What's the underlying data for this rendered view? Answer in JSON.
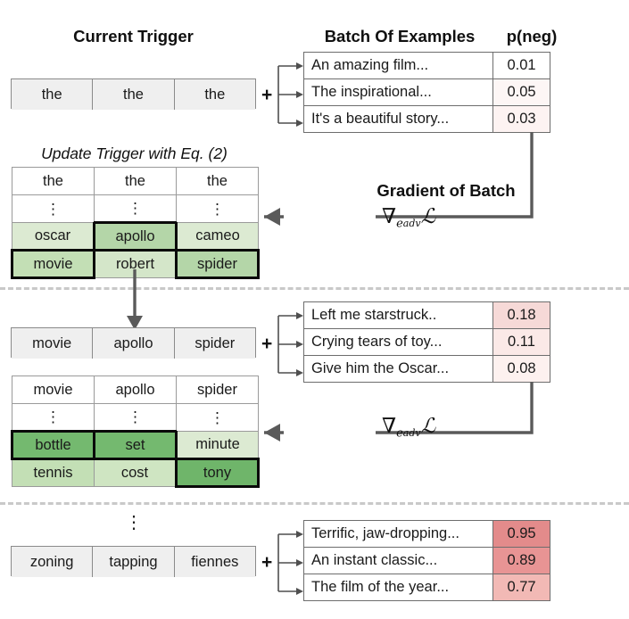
{
  "headings": {
    "current_trigger": "Current Trigger",
    "batch_of_examples": "Batch Of Examples",
    "p_neg": "p(neg)",
    "update_trigger": "Update Trigger with Eq. (2)",
    "gradient_of_batch": "Gradient of Batch"
  },
  "symbols": {
    "plus": "+",
    "nabla": "∇",
    "gradient_subscript": "e",
    "gradient_subscript2": "adv",
    "loss": "ℒ",
    "vertical_dots": "⋮"
  },
  "colors": {
    "green_dark": "#73b873",
    "green_mid": "#a7cfa0",
    "green_light": "#cfe3c4",
    "green_pale": "#e3eedc",
    "pink_dark": "#e08585",
    "pink_mid": "#eeaaaa",
    "pink_light": "#f8dede",
    "pink_pale": "#fdf1f1",
    "pink_faint": "#fdf7f6",
    "grey_box": "#efefef",
    "arrow_grey": "#5a5a5a",
    "dashed_grey": "#c9c9c9"
  },
  "stage1": {
    "trigger": [
      "the",
      "the",
      "the"
    ],
    "examples": [
      {
        "text": "An amazing film...",
        "prob": "0.01",
        "prob_bg": "#ffffff"
      },
      {
        "text": "The inspirational...",
        "prob": "0.05",
        "prob_bg": "#fdf6f5"
      },
      {
        "text": "It's a beautiful story...",
        "prob": "0.03",
        "prob_bg": "#fdf3f2"
      }
    ],
    "grid": {
      "rows": [
        [
          {
            "text": "the",
            "bg": "#ffffff",
            "selected": false
          },
          {
            "text": "the",
            "bg": "#ffffff",
            "selected": false
          },
          {
            "text": "the",
            "bg": "#ffffff",
            "selected": false
          }
        ],
        [
          {
            "text": "⋮",
            "bg": "#ffffff",
            "selected": false
          },
          {
            "text": "⋮",
            "bg": "#ffffff",
            "selected": false
          },
          {
            "text": "⋮",
            "bg": "#ffffff",
            "selected": false
          }
        ],
        [
          {
            "text": "oscar",
            "bg": "#dcead2",
            "selected": false
          },
          {
            "text": "apollo",
            "bg": "#b4d6a8",
            "selected": true
          },
          {
            "text": "cameo",
            "bg": "#dcead2",
            "selected": false
          }
        ],
        [
          {
            "text": "movie",
            "bg": "#c3dfb5",
            "selected": true
          },
          {
            "text": "robert",
            "bg": "#d4e6c9",
            "selected": false
          },
          {
            "text": "spider",
            "bg": "#b4d6a8",
            "selected": true
          }
        ]
      ]
    }
  },
  "stage2": {
    "trigger": [
      "movie",
      "apollo",
      "spider"
    ],
    "examples": [
      {
        "text": "Left me starstruck..",
        "prob": "0.18",
        "prob_bg": "#f6d9d7"
      },
      {
        "text": "Crying tears of toy...",
        "prob": "0.11",
        "prob_bg": "#fbe9e7"
      },
      {
        "text": "Give him the Oscar...",
        "prob": "0.08",
        "prob_bg": "#fdf1ef"
      }
    ],
    "grid": {
      "rows": [
        [
          {
            "text": "movie",
            "bg": "#ffffff",
            "selected": false
          },
          {
            "text": "apollo",
            "bg": "#ffffff",
            "selected": false
          },
          {
            "text": "spider",
            "bg": "#ffffff",
            "selected": false
          }
        ],
        [
          {
            "text": "⋮",
            "bg": "#ffffff",
            "selected": false
          },
          {
            "text": "⋮",
            "bg": "#ffffff",
            "selected": false
          },
          {
            "text": "⋮",
            "bg": "#ffffff",
            "selected": false
          }
        ],
        [
          {
            "text": "bottle",
            "bg": "#74b96f",
            "selected": true
          },
          {
            "text": "set",
            "bg": "#74b96f",
            "selected": true
          },
          {
            "text": "minute",
            "bg": "#dcead2",
            "selected": false
          }
        ],
        [
          {
            "text": "tennis",
            "bg": "#c3dfb5",
            "selected": false
          },
          {
            "text": "cost",
            "bg": "#cfe5c2",
            "selected": false
          },
          {
            "text": "tony",
            "bg": "#6fb56a",
            "selected": true
          }
        ]
      ]
    }
  },
  "stage3": {
    "trigger": [
      "zoning",
      "tapping",
      "fiennes"
    ],
    "examples": [
      {
        "text": "Terrific, jaw-dropping...",
        "prob": "0.95",
        "prob_bg": "#e38b8b"
      },
      {
        "text": "An instant classic...",
        "prob": "0.89",
        "prob_bg": "#e89494"
      },
      {
        "text": "The film of the year...",
        "prob": "0.77",
        "prob_bg": "#f2b9b5"
      }
    ]
  }
}
